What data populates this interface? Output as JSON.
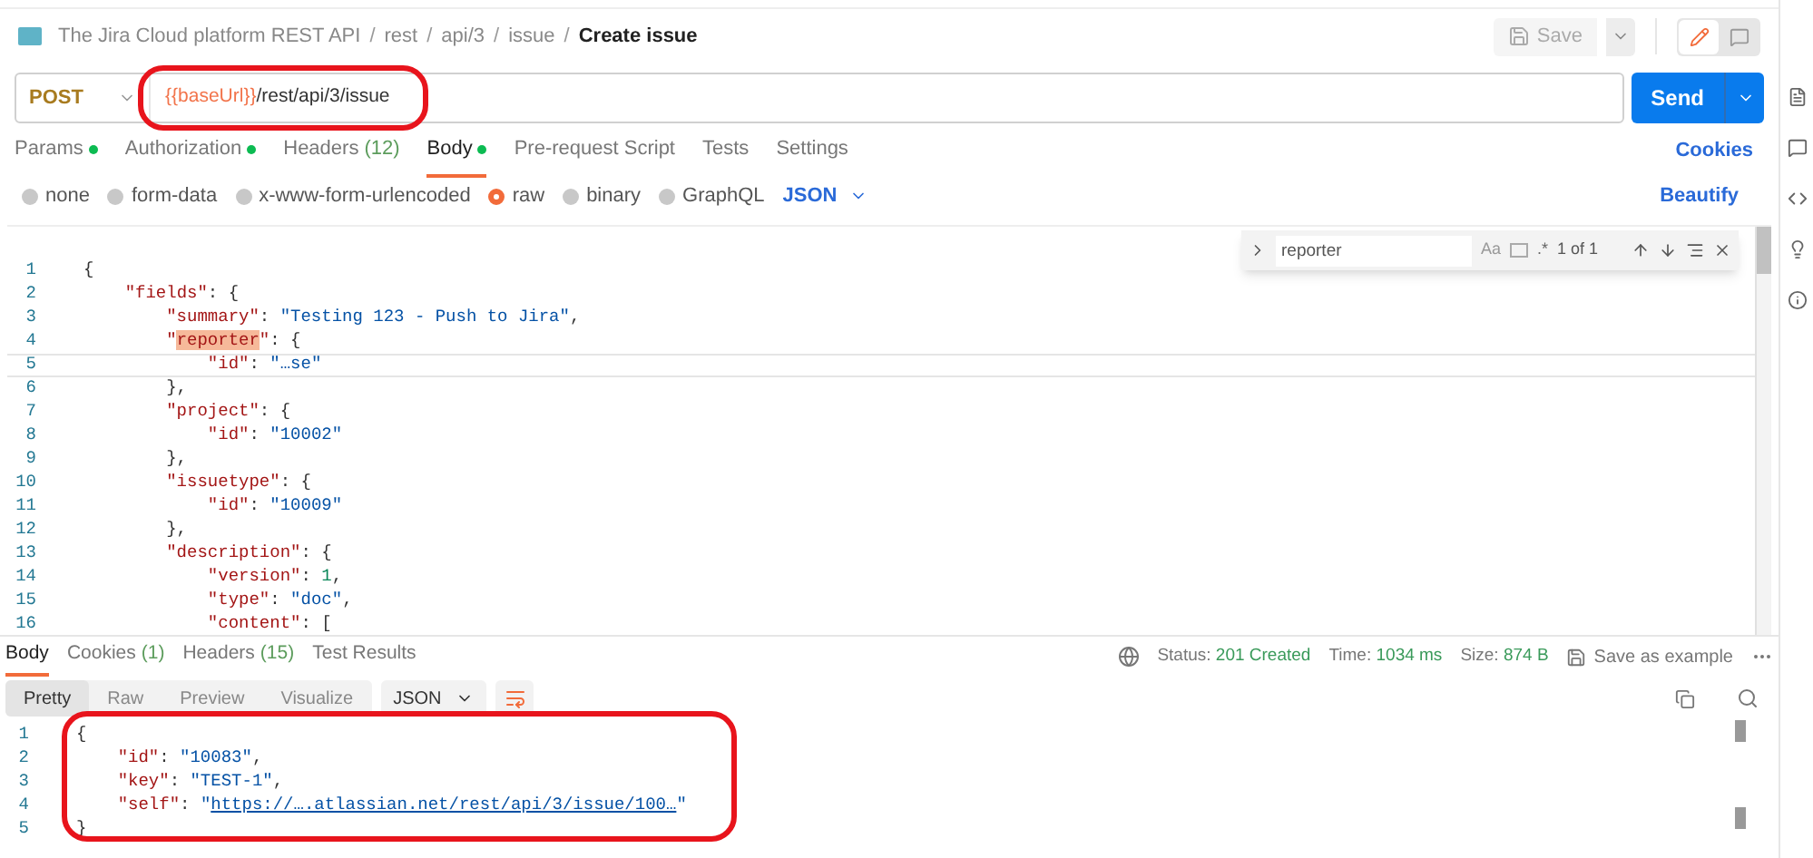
{
  "breadcrumb": {
    "separator": "/",
    "items": [
      "The Jira Cloud platform REST API",
      "rest",
      "api/3",
      "issue",
      "Create issue"
    ]
  },
  "save_button": "Save",
  "mode_buttons": [
    {
      "selected": true
    },
    {
      "selected": false
    }
  ],
  "request": {
    "method": "POST",
    "url_variable": "{{baseUrl}}",
    "url_path": "/rest/api/3/issue",
    "send": "Send"
  },
  "request_tabs": [
    {
      "label": "Params",
      "dot": true,
      "selected": false
    },
    {
      "label": "Authorization",
      "dot": true,
      "selected": false
    },
    {
      "label": "Headers",
      "count": "(12)",
      "dot": false,
      "selected": false
    },
    {
      "label": "Body",
      "dot": true,
      "selected": true
    },
    {
      "label": "Pre-request Script",
      "dot": false,
      "selected": false
    },
    {
      "label": "Tests",
      "dot": false,
      "selected": false
    },
    {
      "label": "Settings",
      "dot": false,
      "selected": false
    }
  ],
  "cookies_link": "Cookies",
  "body_types": [
    {
      "label": "none",
      "selected": false
    },
    {
      "label": "form-data",
      "selected": false
    },
    {
      "label": "x-www-form-urlencoded",
      "selected": false
    },
    {
      "label": "raw",
      "selected": true
    },
    {
      "label": "binary",
      "selected": false
    },
    {
      "label": "GraphQL",
      "selected": false
    }
  ],
  "body_format": "JSON",
  "beautify": "Beautify",
  "find": {
    "value": "reporter",
    "match_case": "Aa",
    "regex": ".*",
    "count": "1 of 1"
  },
  "editor_lines": [
    {
      "number": "1",
      "current": false,
      "text": "{"
    },
    {
      "number": "2",
      "current": false,
      "text": "    \"fields\": {"
    },
    {
      "number": "3",
      "current": false,
      "text": "        \"summary\": \"Testing 123 - Push to Jira\","
    },
    {
      "number": "4",
      "current": false,
      "text": "        \"reporter\": {"
    },
    {
      "number": "5",
      "current": true,
      "text": "            \"id\": \"…se\""
    },
    {
      "number": "6",
      "current": false,
      "text": "        },"
    },
    {
      "number": "7",
      "current": false,
      "text": "        \"project\": {"
    },
    {
      "number": "8",
      "current": false,
      "text": "            \"id\": \"10002\""
    },
    {
      "number": "9",
      "current": false,
      "text": "        },"
    },
    {
      "number": "10",
      "current": false,
      "text": "        \"issuetype\": {"
    },
    {
      "number": "11",
      "current": false,
      "text": "            \"id\": \"10009\""
    },
    {
      "number": "12",
      "current": false,
      "text": "        },"
    },
    {
      "number": "13",
      "current": false,
      "text": "        \"description\": {"
    },
    {
      "number": "14",
      "current": false,
      "text": "            \"version\": 1,"
    },
    {
      "number": "15",
      "current": false,
      "text": "            \"type\": \"doc\","
    },
    {
      "number": "16",
      "current": false,
      "text": "            \"content\": ["
    }
  ],
  "response_tabs": [
    {
      "label": "Body",
      "selected": true
    },
    {
      "label": "Cookies",
      "count": "(1)",
      "selected": false
    },
    {
      "label": "Headers",
      "count": "(15)",
      "selected": false
    },
    {
      "label": "Test Results",
      "selected": false
    }
  ],
  "status": {
    "status_label": "Status:",
    "status_value": "201 Created",
    "time_label": "Time:",
    "time_value": "1034 ms",
    "size_label": "Size:",
    "size_value": "874 B"
  },
  "save_example": "Save as example",
  "view_modes": [
    {
      "label": "Pretty",
      "selected": true
    },
    {
      "label": "Raw",
      "selected": false
    },
    {
      "label": "Preview",
      "selected": false
    },
    {
      "label": "Visualize",
      "selected": false
    }
  ],
  "response_format": "JSON",
  "response_lines": [
    {
      "number": "1",
      "text": "{"
    },
    {
      "number": "2",
      "text": "    \"id\": \"10083\","
    },
    {
      "number": "3",
      "text": "    \"key\": \"TEST-1\","
    },
    {
      "number": "4",
      "link": true,
      "text": "    \"self\": \"https://….atlassian.net/rest/api/3/issue/100…\""
    },
    {
      "number": "5",
      "text": "}"
    }
  ]
}
